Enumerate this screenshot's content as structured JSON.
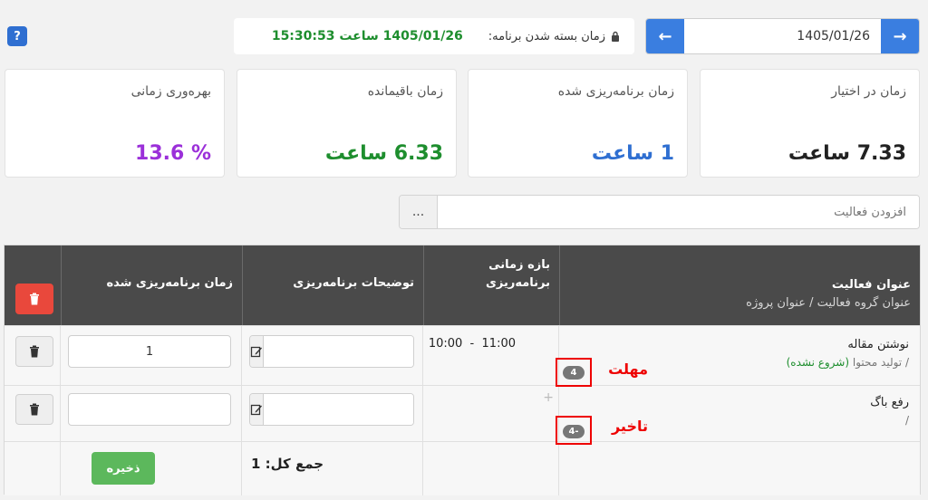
{
  "header": {
    "help_icon": "?",
    "close_time_label": "زمان بسته شدن برنامه:",
    "close_time_value": "1405/01/26 ساعت 15:30:53",
    "date_value": "1405/01/26",
    "prev_icon": "←",
    "next_icon": "→"
  },
  "cards": [
    {
      "title": "زمان در اختیار",
      "value": "7.33 ساعت",
      "color": "#222222"
    },
    {
      "title": "زمان برنامه‌ریزی شده",
      "value": "1 ساعت",
      "color": "#2f6fd1"
    },
    {
      "title": "زمان باقیمانده",
      "value": "6.33 ساعت",
      "color": "#1e8e2e"
    },
    {
      "title": "بهره‌وری زمانی",
      "value": "% 13.6",
      "color": "#9b30d9"
    }
  ],
  "add_activity": {
    "placeholder": "افزودن فعالیت",
    "button_label": "..."
  },
  "table": {
    "headers": {
      "title": "عنوان فعالیت",
      "subtitle": "عنوان گروه فعالیت  / عنوان پروژه",
      "time_range_line1": "بازه زمانی",
      "time_range_line2": "برنامه‌ریزی",
      "description": "توضیحات برنامه‌ریزی",
      "planned_time": "زمان برنامه‌ریزی شده"
    },
    "rows": [
      {
        "name": "نوشتن مقاله",
        "group_prefix": "/ تولید محتوا",
        "status": "(شروع نشده)",
        "badge": "4",
        "annotation": "مهلت",
        "time_from": "10:00",
        "time_to": "11:00",
        "planned_value": "1"
      },
      {
        "name": "رفع باگ",
        "group_prefix": "/",
        "badge": "-4",
        "annotation": "تاخیر",
        "planned_value": ""
      }
    ],
    "total_label": "جمع کل: 1",
    "save_label": "ذخیره"
  }
}
